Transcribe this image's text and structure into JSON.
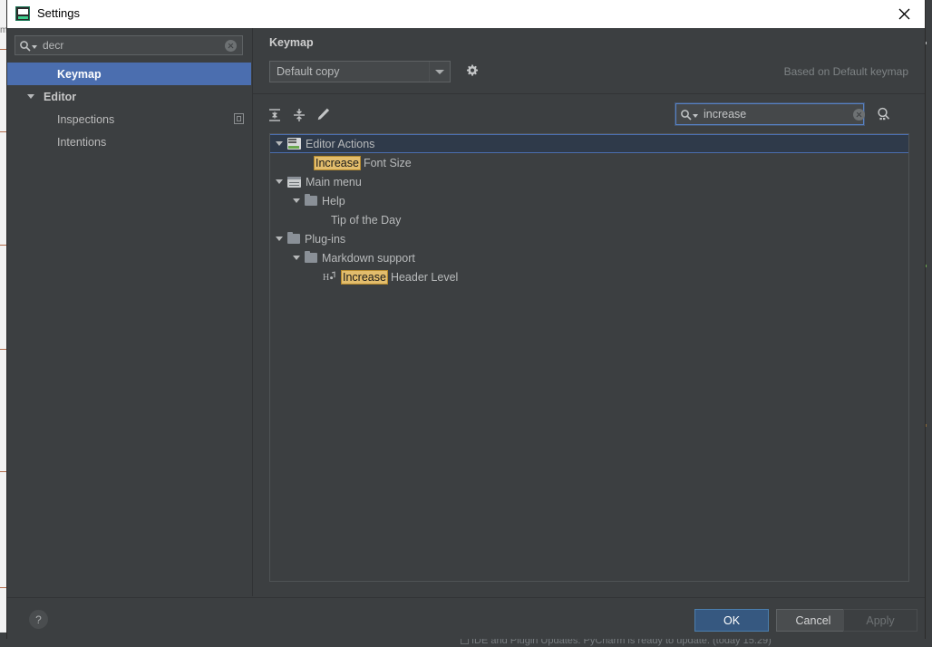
{
  "window": {
    "title": "Settings",
    "icon": "pycharm-icon",
    "close_label": "✕"
  },
  "sidebar": {
    "search": {
      "value": "decr",
      "placeholder": "",
      "icon": "search-icon",
      "clear_icon": "clear-icon"
    },
    "items": [
      {
        "label": "Keymap",
        "indent": 55,
        "selected": true,
        "arrow": false,
        "bold": false,
        "copy_icon": false
      },
      {
        "label": "Editor",
        "indent": 40,
        "selected": false,
        "arrow": true,
        "bold": true,
        "copy_icon": false
      },
      {
        "label": "Inspections",
        "indent": 55,
        "selected": false,
        "arrow": false,
        "bold": false,
        "copy_icon": true
      },
      {
        "label": "Intentions",
        "indent": 55,
        "selected": false,
        "arrow": false,
        "bold": false,
        "copy_icon": false
      }
    ]
  },
  "panel": {
    "title": "Keymap",
    "keymap_select": {
      "value": "Default copy",
      "arrow_icon": "chevron-down-icon"
    },
    "gear_icon": "gear-icon",
    "based_on": "Based on Default keymap",
    "toolbar": {
      "expand_all_icon": "expand-all-icon",
      "collapse_all_icon": "collapse-all-icon",
      "edit_shortcut_icon": "pencil-icon",
      "search": {
        "value": "increase",
        "placeholder": "",
        "icon": "search-icon",
        "clear_icon": "clear-icon"
      },
      "find_by_shortcut_icon": "find-by-shortcut-icon"
    },
    "tree": [
      {
        "label": "Editor Actions",
        "depth": 0,
        "icon": "editor-actions-icon",
        "arrow": "down",
        "selected": true,
        "highlight": ""
      },
      {
        "label": "Font Size",
        "depth": 2,
        "icon": "none",
        "arrow": "none",
        "selected": false,
        "highlight": "Increase"
      },
      {
        "label": "Main menu",
        "depth": 0,
        "icon": "main-menu-icon",
        "arrow": "down",
        "selected": false,
        "highlight": ""
      },
      {
        "label": "Help",
        "depth": 1,
        "icon": "folder-icon",
        "arrow": "down",
        "selected": false,
        "highlight": ""
      },
      {
        "label": "Tip of the Day",
        "depth": 2,
        "icon": "none",
        "arrow": "none",
        "selected": false,
        "highlight": ""
      },
      {
        "label": "Plug-ins",
        "depth": 0,
        "icon": "folder-icon",
        "arrow": "down",
        "selected": false,
        "highlight": ""
      },
      {
        "label": "Markdown support",
        "depth": 1,
        "icon": "folder-icon",
        "arrow": "down",
        "selected": false,
        "highlight": ""
      },
      {
        "label": "Header Level",
        "depth": 2,
        "icon": "header-level-icon",
        "arrow": "none",
        "selected": false,
        "highlight": "Increase"
      }
    ]
  },
  "footer": {
    "help_label": "?",
    "ok_label": "OK",
    "cancel_label": "Cancel",
    "apply_label": "Apply"
  },
  "ide": {
    "status_text": "IDE and Plugin Updates: PyCharm is ready to update. (today 15:29)",
    "left_edge_text": "m"
  },
  "colors": {
    "accent_blue": "#4b6eaf",
    "ok_button": "#365880",
    "highlight_yellow": "#e3bd6c",
    "panel_bg": "#3c3f41",
    "field_bg": "#45484a"
  }
}
